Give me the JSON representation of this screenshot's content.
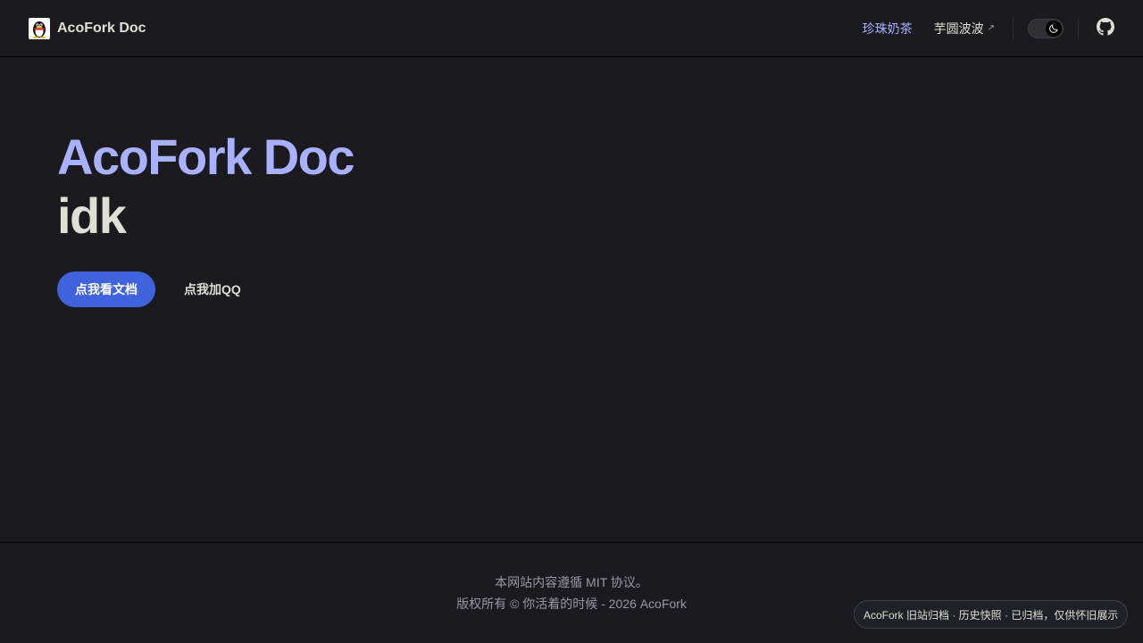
{
  "navbar": {
    "brand_title": "AcoFork Doc",
    "links": [
      {
        "label": "珍珠奶茶",
        "active": true
      },
      {
        "label": "芋圆波波",
        "external_icon": "↗"
      }
    ],
    "theme_toggle_icon": "moon-icon",
    "github_icon": "github-icon"
  },
  "hero": {
    "name": "AcoFork Doc",
    "text": "idk",
    "actions": [
      {
        "label": "点我看文档",
        "theme": "brand"
      },
      {
        "label": "点我加QQ",
        "theme": "alt"
      }
    ]
  },
  "footer": {
    "message": "本网站内容遵循 MIT 协议。",
    "copyright": "版权所有 © 你活着的时候 - 2026 AcoFork"
  },
  "archive_badge": "AcoFork 旧站归档 · 历史快照 · 已归档，仅供怀旧展示",
  "colors": {
    "background": "#1b1b1f",
    "brand": "#a8b1ff",
    "button": "#3e63dd",
    "text": "#dfdfd6",
    "muted": "#98989f"
  }
}
